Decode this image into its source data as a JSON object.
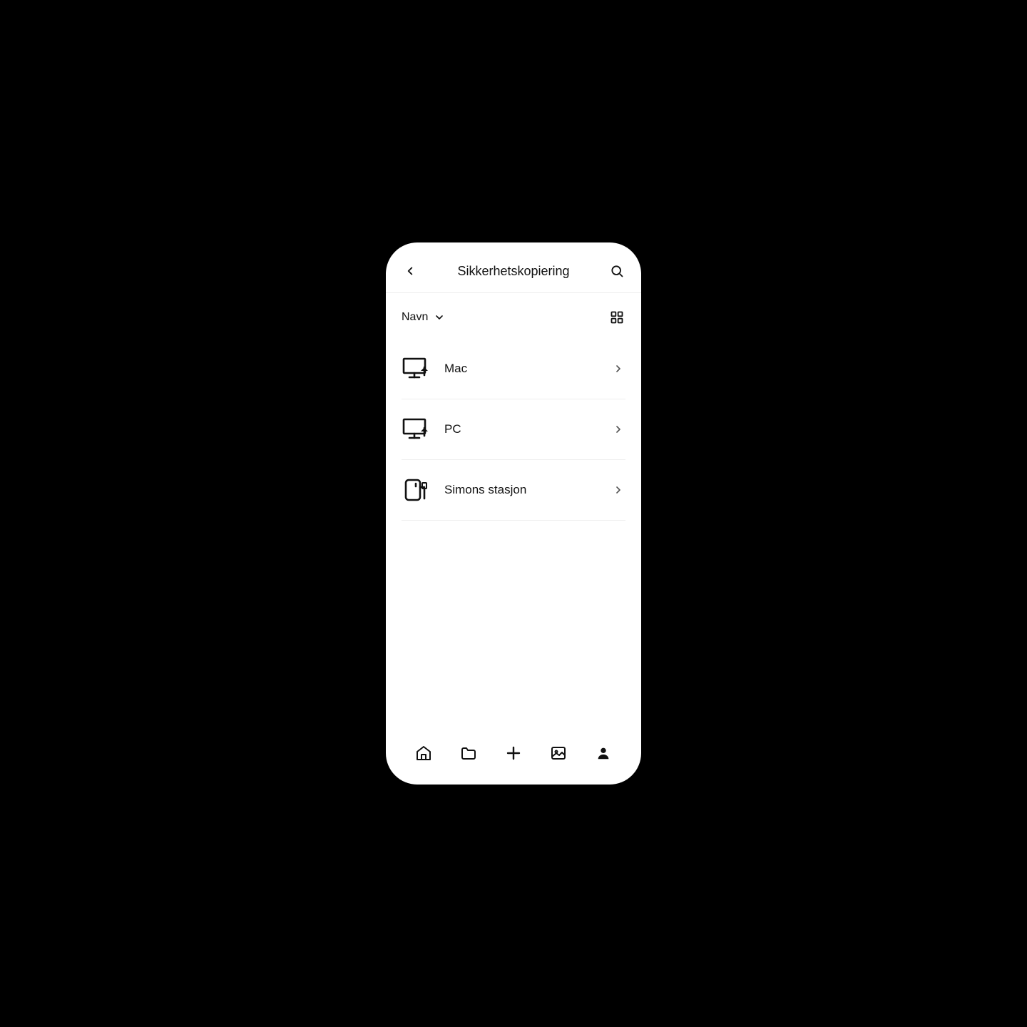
{
  "header": {
    "title": "Sikkerhetskopiering"
  },
  "sort": {
    "label": "Navn"
  },
  "items": [
    {
      "label": "Mac",
      "icon": "computer-backup"
    },
    {
      "label": "PC",
      "icon": "computer-backup"
    },
    {
      "label": "Simons stasjon",
      "icon": "external-drive"
    }
  ],
  "tabs": [
    {
      "name": "home"
    },
    {
      "name": "files"
    },
    {
      "name": "add"
    },
    {
      "name": "photos"
    },
    {
      "name": "account"
    }
  ]
}
